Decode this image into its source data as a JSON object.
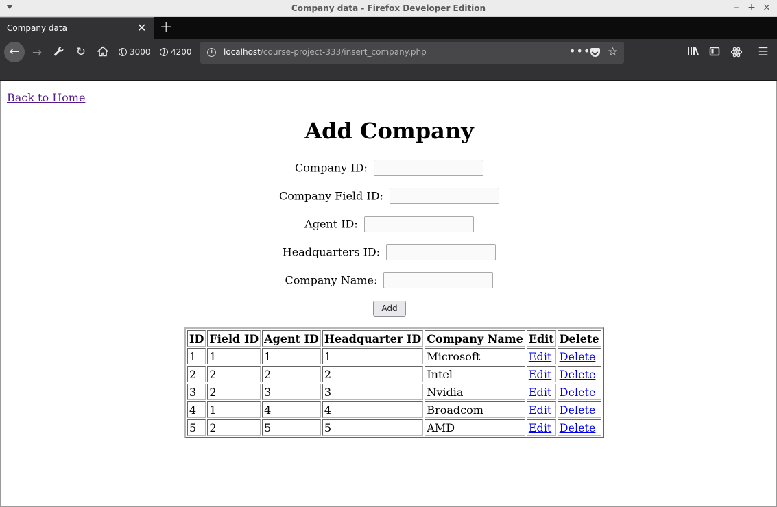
{
  "window": {
    "title": "Company data - Firefox Developer Edition"
  },
  "tab": {
    "title": "Company data",
    "close_glyph": "✕",
    "new_tab_glyph": "+"
  },
  "navbar": {
    "bookmarks": [
      "3000",
      "4200"
    ],
    "url_host": "localhost",
    "url_path": "/course-project-333/insert_company.php",
    "page_actions_glyph": "•••"
  },
  "page": {
    "back_link": "Back to Home",
    "heading": "Add Company",
    "form": {
      "fields": [
        {
          "label": "Company ID:",
          "value": ""
        },
        {
          "label": "Company Field ID:",
          "value": ""
        },
        {
          "label": "Agent ID:",
          "value": ""
        },
        {
          "label": "Headquarters ID:",
          "value": ""
        },
        {
          "label": "Company Name:",
          "value": ""
        }
      ],
      "submit_label": "Add"
    },
    "table": {
      "headers": [
        "ID",
        "Field ID",
        "Agent ID",
        "Headquarter ID",
        "Company Name",
        "Edit",
        "Delete"
      ],
      "rows": [
        {
          "id": "1",
          "field_id": "1",
          "agent_id": "1",
          "hq_id": "1",
          "name": "Microsoft",
          "edit": "Edit",
          "delete": "Delete"
        },
        {
          "id": "2",
          "field_id": "2",
          "agent_id": "2",
          "hq_id": "2",
          "name": "Intel",
          "edit": "Edit",
          "delete": "Delete"
        },
        {
          "id": "3",
          "field_id": "2",
          "agent_id": "3",
          "hq_id": "3",
          "name": "Nvidia",
          "edit": "Edit",
          "delete": "Delete"
        },
        {
          "id": "4",
          "field_id": "1",
          "agent_id": "4",
          "hq_id": "4",
          "name": "Broadcom",
          "edit": "Edit",
          "delete": "Delete"
        },
        {
          "id": "5",
          "field_id": "2",
          "agent_id": "5",
          "hq_id": "5",
          "name": "AMD",
          "edit": "Edit",
          "delete": "Delete"
        }
      ]
    }
  }
}
